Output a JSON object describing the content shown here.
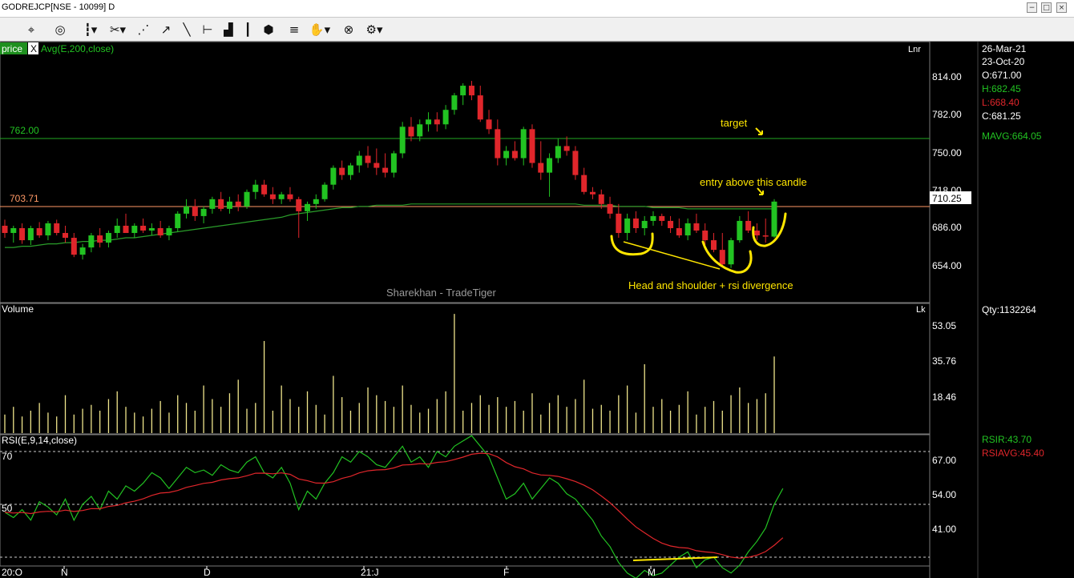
{
  "window": {
    "title": "GODREJCP[NSE - 10099] D",
    "buttons": [
      "−",
      "□",
      "×"
    ]
  },
  "toolbar": {
    "icons": [
      "crosshair-cursor-icon",
      "target-icon",
      "candlestick-icon",
      "draw-tools-icon",
      "fibonacci-icon",
      "trendline-icon",
      "line-icon",
      "horizontal-line-icon",
      "volume-bars-icon",
      "3d-box-icon",
      "parallel-lines-icon",
      "hand-pan-icon",
      "compare-icon",
      "settings-gear-icon"
    ]
  },
  "price_panel": {
    "legend_price": "price",
    "legend_close": "X",
    "legend_avg": "Avg(E,200,close)",
    "scale_type": "Lnr",
    "y_ticks": [
      "814.00",
      "782.00",
      "750.00",
      "718.00",
      "686.00",
      "654.00"
    ],
    "level_762": "762.00",
    "level_703": "703.71",
    "current_price": "710.25",
    "watermark": "Sharekhan - TradeTiger",
    "annotation_target": "target",
    "annotation_entry": "entry above this candle",
    "annotation_pattern": "Head and shoulder + rsi divergence"
  },
  "info": {
    "date1": "26-Mar-21",
    "date2": "23-Oct-20",
    "open": "O:671.00",
    "high": "H:682.45",
    "low": "L:668.40",
    "close": "C:681.25",
    "mavg": "MAVG:664.05",
    "qty": "Qty:1132264",
    "rsir": "RSIR:43.70",
    "rsiavg": "RSIAVG:45.40"
  },
  "volume_panel": {
    "title": "Volume",
    "unit": "Lk",
    "y_ticks": [
      "53.05",
      "35.76",
      "18.46"
    ]
  },
  "rsi_panel": {
    "title": "RSI(E,9,14,close)",
    "y_ticks": [
      "67.00",
      "54.00",
      "41.00"
    ],
    "left_70": "70",
    "left_50": "50"
  },
  "x_axis": {
    "labels": [
      "20:O",
      "N",
      "D",
      "21:J",
      "F",
      "M"
    ]
  },
  "colors": {
    "up": "#22c322",
    "down": "#e0262b",
    "avg": "#2a9d2a",
    "volume": "#f0e68c",
    "rsi": "#22c322",
    "rsiavg": "#e0262b",
    "annotation": "#ffe600",
    "level_762": "#22a822",
    "level_703": "#ff9966"
  },
  "chart_data": {
    "type": "candlestick",
    "series_price": [
      {
        "o": 690,
        "h": 695,
        "l": 680,
        "c": 684
      },
      {
        "o": 684,
        "h": 690,
        "l": 676,
        "c": 688
      },
      {
        "o": 688,
        "h": 692,
        "l": 675,
        "c": 678
      },
      {
        "o": 678,
        "h": 690,
        "l": 674,
        "c": 688
      },
      {
        "o": 688,
        "h": 693,
        "l": 680,
        "c": 682
      },
      {
        "o": 682,
        "h": 694,
        "l": 678,
        "c": 692
      },
      {
        "o": 692,
        "h": 695,
        "l": 682,
        "c": 684
      },
      {
        "o": 684,
        "h": 690,
        "l": 676,
        "c": 680
      },
      {
        "o": 680,
        "h": 684,
        "l": 664,
        "c": 666
      },
      {
        "o": 666,
        "h": 675,
        "l": 662,
        "c": 672
      },
      {
        "o": 672,
        "h": 684,
        "l": 668,
        "c": 682
      },
      {
        "o": 682,
        "h": 688,
        "l": 672,
        "c": 676
      },
      {
        "o": 676,
        "h": 686,
        "l": 672,
        "c": 684
      },
      {
        "o": 684,
        "h": 696,
        "l": 680,
        "c": 690
      },
      {
        "o": 690,
        "h": 700,
        "l": 684,
        "c": 684
      },
      {
        "o": 684,
        "h": 692,
        "l": 680,
        "c": 690
      },
      {
        "o": 690,
        "h": 696,
        "l": 684,
        "c": 686
      },
      {
        "o": 686,
        "h": 692,
        "l": 682,
        "c": 688
      },
      {
        "o": 688,
        "h": 694,
        "l": 680,
        "c": 682
      },
      {
        "o": 682,
        "h": 690,
        "l": 678,
        "c": 688
      },
      {
        "o": 688,
        "h": 702,
        "l": 685,
        "c": 700
      },
      {
        "o": 700,
        "h": 712,
        "l": 696,
        "c": 706
      },
      {
        "o": 706,
        "h": 712,
        "l": 694,
        "c": 698
      },
      {
        "o": 698,
        "h": 706,
        "l": 692,
        "c": 704
      },
      {
        "o": 704,
        "h": 714,
        "l": 700,
        "c": 712
      },
      {
        "o": 712,
        "h": 718,
        "l": 702,
        "c": 704
      },
      {
        "o": 704,
        "h": 714,
        "l": 700,
        "c": 710
      },
      {
        "o": 710,
        "h": 716,
        "l": 702,
        "c": 706
      },
      {
        "o": 706,
        "h": 720,
        "l": 704,
        "c": 718
      },
      {
        "o": 718,
        "h": 728,
        "l": 712,
        "c": 724
      },
      {
        "o": 724,
        "h": 728,
        "l": 714,
        "c": 716
      },
      {
        "o": 716,
        "h": 722,
        "l": 708,
        "c": 712
      },
      {
        "o": 712,
        "h": 718,
        "l": 708,
        "c": 716
      },
      {
        "o": 716,
        "h": 722,
        "l": 710,
        "c": 712
      },
      {
        "o": 712,
        "h": 714,
        "l": 680,
        "c": 702
      },
      {
        "o": 702,
        "h": 710,
        "l": 694,
        "c": 708
      },
      {
        "o": 708,
        "h": 716,
        "l": 704,
        "c": 712
      },
      {
        "o": 712,
        "h": 726,
        "l": 710,
        "c": 724
      },
      {
        "o": 724,
        "h": 740,
        "l": 720,
        "c": 738
      },
      {
        "o": 738,
        "h": 744,
        "l": 728,
        "c": 732
      },
      {
        "o": 732,
        "h": 742,
        "l": 728,
        "c": 740
      },
      {
        "o": 740,
        "h": 752,
        "l": 734,
        "c": 748
      },
      {
        "o": 748,
        "h": 756,
        "l": 738,
        "c": 742
      },
      {
        "o": 742,
        "h": 754,
        "l": 732,
        "c": 738
      },
      {
        "o": 738,
        "h": 750,
        "l": 730,
        "c": 734
      },
      {
        "o": 734,
        "h": 752,
        "l": 730,
        "c": 750
      },
      {
        "o": 750,
        "h": 776,
        "l": 746,
        "c": 772
      },
      {
        "o": 772,
        "h": 780,
        "l": 760,
        "c": 764
      },
      {
        "o": 764,
        "h": 778,
        "l": 760,
        "c": 774
      },
      {
        "o": 774,
        "h": 784,
        "l": 768,
        "c": 778
      },
      {
        "o": 778,
        "h": 784,
        "l": 768,
        "c": 774
      },
      {
        "o": 774,
        "h": 790,
        "l": 770,
        "c": 786
      },
      {
        "o": 786,
        "h": 800,
        "l": 782,
        "c": 798
      },
      {
        "o": 798,
        "h": 808,
        "l": 790,
        "c": 806
      },
      {
        "o": 806,
        "h": 810,
        "l": 794,
        "c": 798
      },
      {
        "o": 798,
        "h": 806,
        "l": 776,
        "c": 778
      },
      {
        "o": 778,
        "h": 786,
        "l": 766,
        "c": 770
      },
      {
        "o": 770,
        "h": 778,
        "l": 740,
        "c": 746
      },
      {
        "o": 746,
        "h": 756,
        "l": 740,
        "c": 752
      },
      {
        "o": 752,
        "h": 760,
        "l": 744,
        "c": 746
      },
      {
        "o": 746,
        "h": 772,
        "l": 740,
        "c": 770
      },
      {
        "o": 770,
        "h": 774,
        "l": 738,
        "c": 742
      },
      {
        "o": 742,
        "h": 760,
        "l": 728,
        "c": 734
      },
      {
        "o": 734,
        "h": 750,
        "l": 714,
        "c": 746
      },
      {
        "o": 746,
        "h": 762,
        "l": 742,
        "c": 756
      },
      {
        "o": 756,
        "h": 764,
        "l": 748,
        "c": 752
      },
      {
        "o": 752,
        "h": 756,
        "l": 728,
        "c": 732
      },
      {
        "o": 732,
        "h": 738,
        "l": 716,
        "c": 718
      },
      {
        "o": 718,
        "h": 722,
        "l": 712,
        "c": 716
      },
      {
        "o": 716,
        "h": 720,
        "l": 704,
        "c": 708
      },
      {
        "o": 708,
        "h": 714,
        "l": 696,
        "c": 700
      },
      {
        "o": 700,
        "h": 708,
        "l": 680,
        "c": 684
      },
      {
        "o": 684,
        "h": 700,
        "l": 678,
        "c": 696
      },
      {
        "o": 696,
        "h": 702,
        "l": 684,
        "c": 688
      },
      {
        "o": 688,
        "h": 698,
        "l": 682,
        "c": 694
      },
      {
        "o": 694,
        "h": 702,
        "l": 690,
        "c": 698
      },
      {
        "o": 698,
        "h": 700,
        "l": 690,
        "c": 694
      },
      {
        "o": 694,
        "h": 698,
        "l": 684,
        "c": 688
      },
      {
        "o": 688,
        "h": 696,
        "l": 680,
        "c": 682
      },
      {
        "o": 682,
        "h": 696,
        "l": 678,
        "c": 692
      },
      {
        "o": 692,
        "h": 700,
        "l": 684,
        "c": 686
      },
      {
        "o": 686,
        "h": 692,
        "l": 674,
        "c": 678
      },
      {
        "o": 678,
        "h": 684,
        "l": 668,
        "c": 670
      },
      {
        "o": 670,
        "h": 684,
        "l": 656,
        "c": 658
      },
      {
        "o": 658,
        "h": 680,
        "l": 655,
        "c": 678
      },
      {
        "o": 678,
        "h": 698,
        "l": 676,
        "c": 694
      },
      {
        "o": 694,
        "h": 702,
        "l": 684,
        "c": 686
      },
      {
        "o": 686,
        "h": 692,
        "l": 678,
        "c": 682
      },
      {
        "o": 682,
        "h": 696,
        "l": 676,
        "c": 681
      },
      {
        "o": 681,
        "h": 712,
        "l": 680,
        "c": 710
      }
    ],
    "avg200": [
      672,
      672,
      673,
      673,
      674,
      675,
      675,
      676,
      676,
      677,
      677,
      678,
      678,
      679,
      680,
      680,
      681,
      682,
      683,
      684,
      685,
      686,
      687,
      688,
      689,
      690,
      691,
      692,
      693,
      694,
      695,
      696,
      697,
      699,
      700,
      701,
      702,
      703,
      704,
      705,
      705,
      706,
      706,
      707,
      707,
      707,
      707,
      708,
      708,
      708,
      708,
      708,
      708,
      708,
      708,
      708,
      708,
      708,
      708,
      708,
      708,
      708,
      708,
      708,
      708,
      708,
      708,
      707,
      707,
      707,
      707,
      706,
      706,
      706,
      706,
      705,
      705,
      705,
      705,
      704,
      704,
      704,
      704,
      704,
      704,
      704,
      704,
      704,
      704,
      704
    ],
    "volume": [
      10,
      14,
      9,
      12,
      16,
      11,
      9,
      20,
      10,
      13,
      15,
      12,
      18,
      22,
      14,
      11,
      9,
      13,
      17,
      11,
      20,
      16,
      12,
      25,
      18,
      14,
      21,
      28,
      13,
      16,
      48,
      12,
      25,
      18,
      14,
      22,
      15,
      10,
      30,
      19,
      12,
      16,
      24,
      20,
      17,
      14,
      25,
      15,
      11,
      13,
      18,
      22,
      62,
      12,
      16,
      20,
      15,
      19,
      14,
      17,
      12,
      21,
      10,
      16,
      20,
      14,
      18,
      28,
      13,
      15,
      12,
      20,
      25,
      11,
      36,
      14,
      18,
      12,
      15,
      22,
      10,
      14,
      17,
      12,
      20,
      24,
      16,
      18,
      21,
      40
    ],
    "rsi": [
      47,
      45,
      48,
      44,
      51,
      49,
      46,
      52,
      44,
      50,
      53,
      48,
      55,
      52,
      57,
      55,
      58,
      62,
      60,
      56,
      60,
      64,
      62,
      63,
      61,
      65,
      63,
      62,
      66,
      68,
      62,
      60,
      64,
      58,
      48,
      55,
      52,
      58,
      62,
      68,
      66,
      70,
      68,
      65,
      64,
      68,
      72,
      66,
      68,
      64,
      70,
      68,
      72,
      74,
      76,
      72,
      68,
      60,
      52,
      54,
      58,
      52,
      56,
      60,
      58,
      54,
      52,
      48,
      44,
      38,
      34,
      28,
      24,
      22,
      25,
      23,
      24,
      27,
      30,
      32,
      26,
      29,
      30,
      26,
      24,
      27,
      32,
      36,
      41,
      50,
      56
    ]
  }
}
